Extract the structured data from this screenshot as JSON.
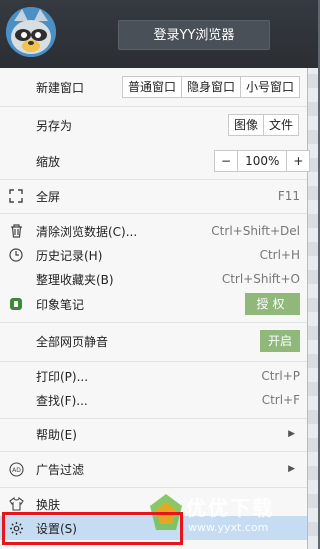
{
  "header": {
    "login_label": "登录YY浏览器"
  },
  "new_window": {
    "label": "新建窗口",
    "options": [
      "普通窗口",
      "隐身窗口",
      "小号窗口"
    ]
  },
  "save_as": {
    "label": "另存为",
    "options": [
      "图像",
      "文件"
    ]
  },
  "zoom": {
    "label": "缩放",
    "minus": "−",
    "value": "100%",
    "plus": "+"
  },
  "fullscreen": {
    "label": "全屏",
    "shortcut": "F11"
  },
  "items": [
    {
      "label": "清除浏览数据(C)...",
      "shortcut": "Ctrl+Shift+Del"
    },
    {
      "label": "历史记录(H)",
      "shortcut": "Ctrl+H"
    },
    {
      "label": "整理收藏夹(B)",
      "shortcut": "Ctrl+Shift+O"
    },
    {
      "label": "印象笔记",
      "button": "授权"
    },
    {
      "label": "全部网页静音",
      "button": "开启"
    },
    {
      "label": "打印(P)...",
      "shortcut": "Ctrl+P"
    },
    {
      "label": "查找(F)...",
      "shortcut": "Ctrl+F"
    },
    {
      "label": "帮助(E)"
    },
    {
      "label": "广告过滤"
    },
    {
      "label": "换肤"
    },
    {
      "label": "设置(S)"
    }
  ],
  "watermark": {
    "text": "优优下载",
    "url": "www.yyxt.com"
  },
  "colors": {
    "header": "#2f3439",
    "selected_row": "#c6dcf3",
    "green_button": "#8fb87a",
    "highlight_border": "#e8141b"
  }
}
